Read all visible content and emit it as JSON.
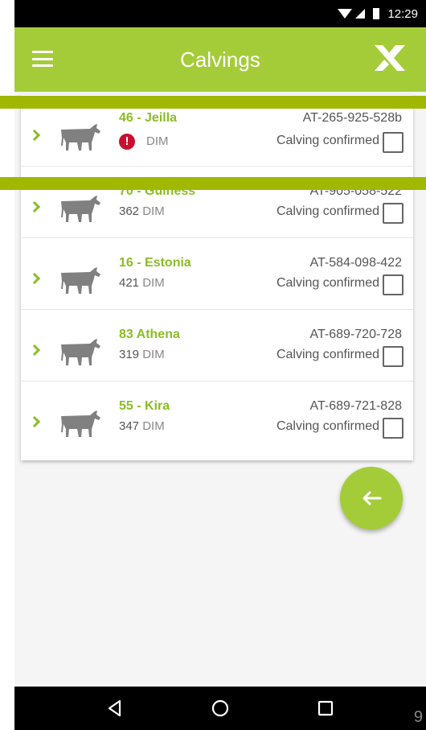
{
  "status_bar": {
    "time": "12:29"
  },
  "app_bar": {
    "title": "Calvings"
  },
  "rows": [
    {
      "name": "46 - Jeilla",
      "dim_value": "",
      "dim_unit": "DIM",
      "tag": "AT-265-925-528b",
      "status": "Calving confirmed",
      "alert": true
    },
    {
      "name": "70 - Guiness",
      "dim_value": "362",
      "dim_unit": "DIM",
      "tag": "AT-905-058-522",
      "status": "Calving confirmed",
      "alert": false
    },
    {
      "name": "16 - Estonia",
      "dim_value": "421",
      "dim_unit": "DIM",
      "tag": "AT-584-098-422",
      "status": "Calving confirmed",
      "alert": false
    },
    {
      "name": "83 Athena",
      "dim_value": "319",
      "dim_unit": "DIM",
      "tag": "AT-689-720-728",
      "status": "Calving confirmed",
      "alert": false
    },
    {
      "name": "55 - Kira",
      "dim_value": "347",
      "dim_unit": "DIM",
      "tag": "AT-689-721-828",
      "status": "Calving confirmed",
      "alert": false
    }
  ],
  "alert_glyph": "!",
  "page_number": "9",
  "colors": {
    "accent": "#a4cc38",
    "label_green": "#8bbd25",
    "alert_red": "#c8102e",
    "overlay": "#a0b800"
  }
}
